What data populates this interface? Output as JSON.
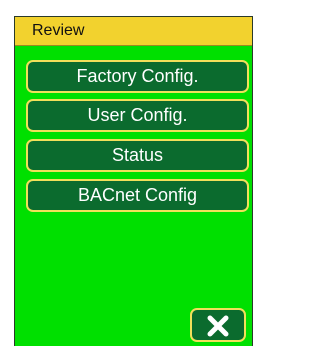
{
  "header": {
    "title": "Review"
  },
  "menu": {
    "items": [
      {
        "label": "Factory Config."
      },
      {
        "label": "User Config."
      },
      {
        "label": "Status"
      },
      {
        "label": "BACnet Config"
      }
    ]
  },
  "controls": {
    "close_icon": "close-x-icon"
  },
  "colors": {
    "screen_background": "#00e000",
    "header_background": "#f2d22e",
    "button_fill": "#0b6b2e",
    "button_border": "#f2e05a",
    "button_text": "#ffffff"
  }
}
